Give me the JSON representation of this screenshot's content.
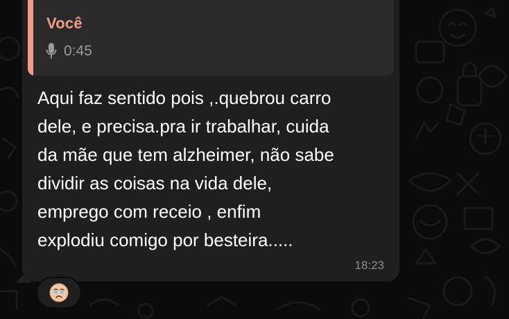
{
  "quoted_message": {
    "author": "Você",
    "type_icon": "microphone-icon",
    "duration": "0:45",
    "accent_color": "#f49b86"
  },
  "message": {
    "text": "Aqui faz sentido pois ,.quebrou carro\ndele, e precisa.pra ir trabalhar, cuida\nda mãe que tem alzheimer, não sabe\ndividir as coisas na vida dele,\nemprego com receio , enfim\nexplodiu comigo por besteira.....",
    "time": "18:23"
  },
  "reaction": {
    "emoji_name": "crying-face-emoji"
  },
  "colors": {
    "background": "#0b0b0b",
    "bubble": "#1f1f1f",
    "quote_background": "#2a2a2a"
  }
}
